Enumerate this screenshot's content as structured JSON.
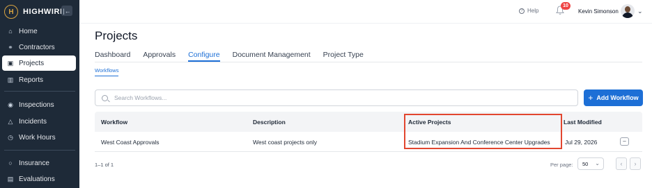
{
  "app": {
    "brand": "HIGHWIRE",
    "logo_letter": "H"
  },
  "sidebar": {
    "collapse_icon": "collapse-icon",
    "items": [
      {
        "label": "Home",
        "icon": "home-icon",
        "glyph": "⌂"
      },
      {
        "label": "Contractors",
        "icon": "contractors-icon",
        "glyph": "⚭"
      },
      {
        "label": "Projects",
        "icon": "projects-icon",
        "glyph": "▣",
        "active": true
      },
      {
        "label": "Reports",
        "icon": "reports-icon",
        "glyph": "▥"
      },
      {
        "label": "Inspections",
        "icon": "inspections-icon",
        "glyph": "◉"
      },
      {
        "label": "Incidents",
        "icon": "incidents-icon",
        "glyph": "△"
      },
      {
        "label": "Work Hours",
        "icon": "clock-icon",
        "glyph": "◷"
      },
      {
        "label": "Insurance",
        "icon": "insurance-icon",
        "glyph": "○"
      },
      {
        "label": "Evaluations",
        "icon": "evaluations-icon",
        "glyph": "▤"
      }
    ]
  },
  "header": {
    "help_label": "Help",
    "notifications_count": "10",
    "user_name": "Kevin Simonson"
  },
  "page": {
    "title": "Projects",
    "tabs": [
      {
        "label": "Dashboard"
      },
      {
        "label": "Approvals"
      },
      {
        "label": "Configure",
        "active": true
      },
      {
        "label": "Document Management"
      },
      {
        "label": "Project Type"
      }
    ],
    "subtab": "Workflows"
  },
  "search": {
    "placeholder": "Search Workflows..."
  },
  "add_button": {
    "label": "Add Workflow"
  },
  "table": {
    "headers": {
      "workflow": "Workflow",
      "description": "Description",
      "active_projects": "Active Projects",
      "last_modified": "Last Modified"
    },
    "rows": [
      {
        "workflow": "West Coast Approvals",
        "description": "West coast projects only",
        "active_projects": "Stadium Expansion And Conference Center Upgrades",
        "last_modified": "Jul 29, 2026"
      }
    ]
  },
  "pagination": {
    "range": "1–1 of 1",
    "per_page_label": "Per page:",
    "per_page_value": "50"
  },
  "colors": {
    "sidebar": "#1e2a38",
    "accent": "#1d6fd6",
    "highlight": "#e2462f",
    "badge": "#ef4444"
  }
}
